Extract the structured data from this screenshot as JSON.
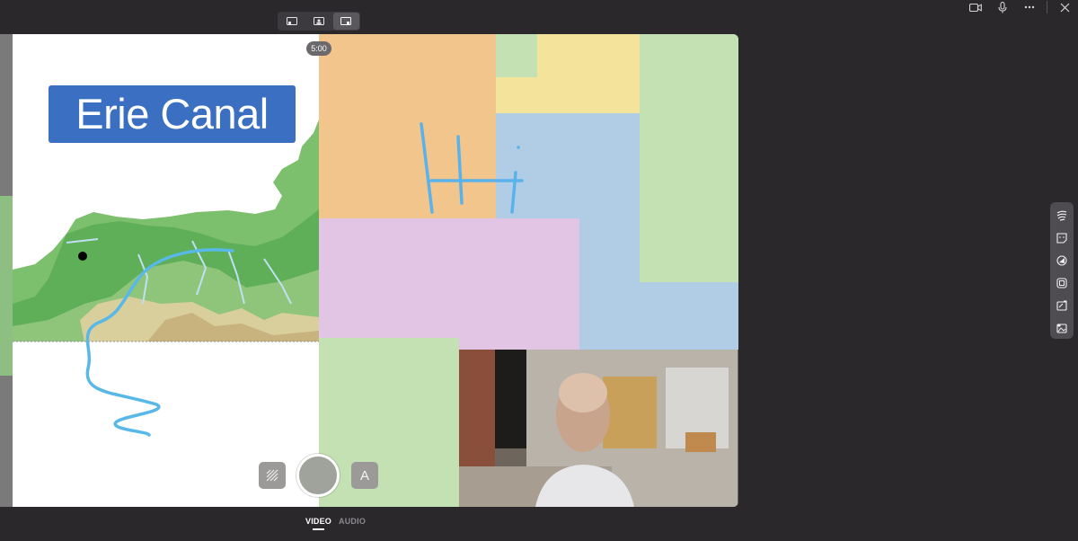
{
  "window": {
    "controls": [
      {
        "name": "camera-icon"
      },
      {
        "name": "microphone-icon"
      },
      {
        "name": "more-icon"
      },
      {
        "name": "close-icon"
      }
    ]
  },
  "layout_switch": {
    "options": [
      "presenter-left-layout",
      "presenter-center-layout",
      "presenter-right-layout"
    ],
    "active": 2
  },
  "board": {
    "title": "Erie Canal",
    "handwriting": "Hi",
    "timer": "5:00",
    "note_colors": {
      "orange": "#f2c58d",
      "yellow": "#f3e39b",
      "blue": "#b1cde6",
      "green": "#c3e1b3",
      "pink": "#e2c4e4"
    }
  },
  "capture_controls": {
    "background_icon": "background-blur-icon",
    "text_button": "A"
  },
  "tools": [
    "pen-icon",
    "sticky-note-icon",
    "stickers-icon",
    "frame-icon",
    "text-note-icon",
    "add-image-icon"
  ],
  "tabs": [
    {
      "label": "VIDEO",
      "active": true
    },
    {
      "label": "AUDIO",
      "active": false
    }
  ]
}
